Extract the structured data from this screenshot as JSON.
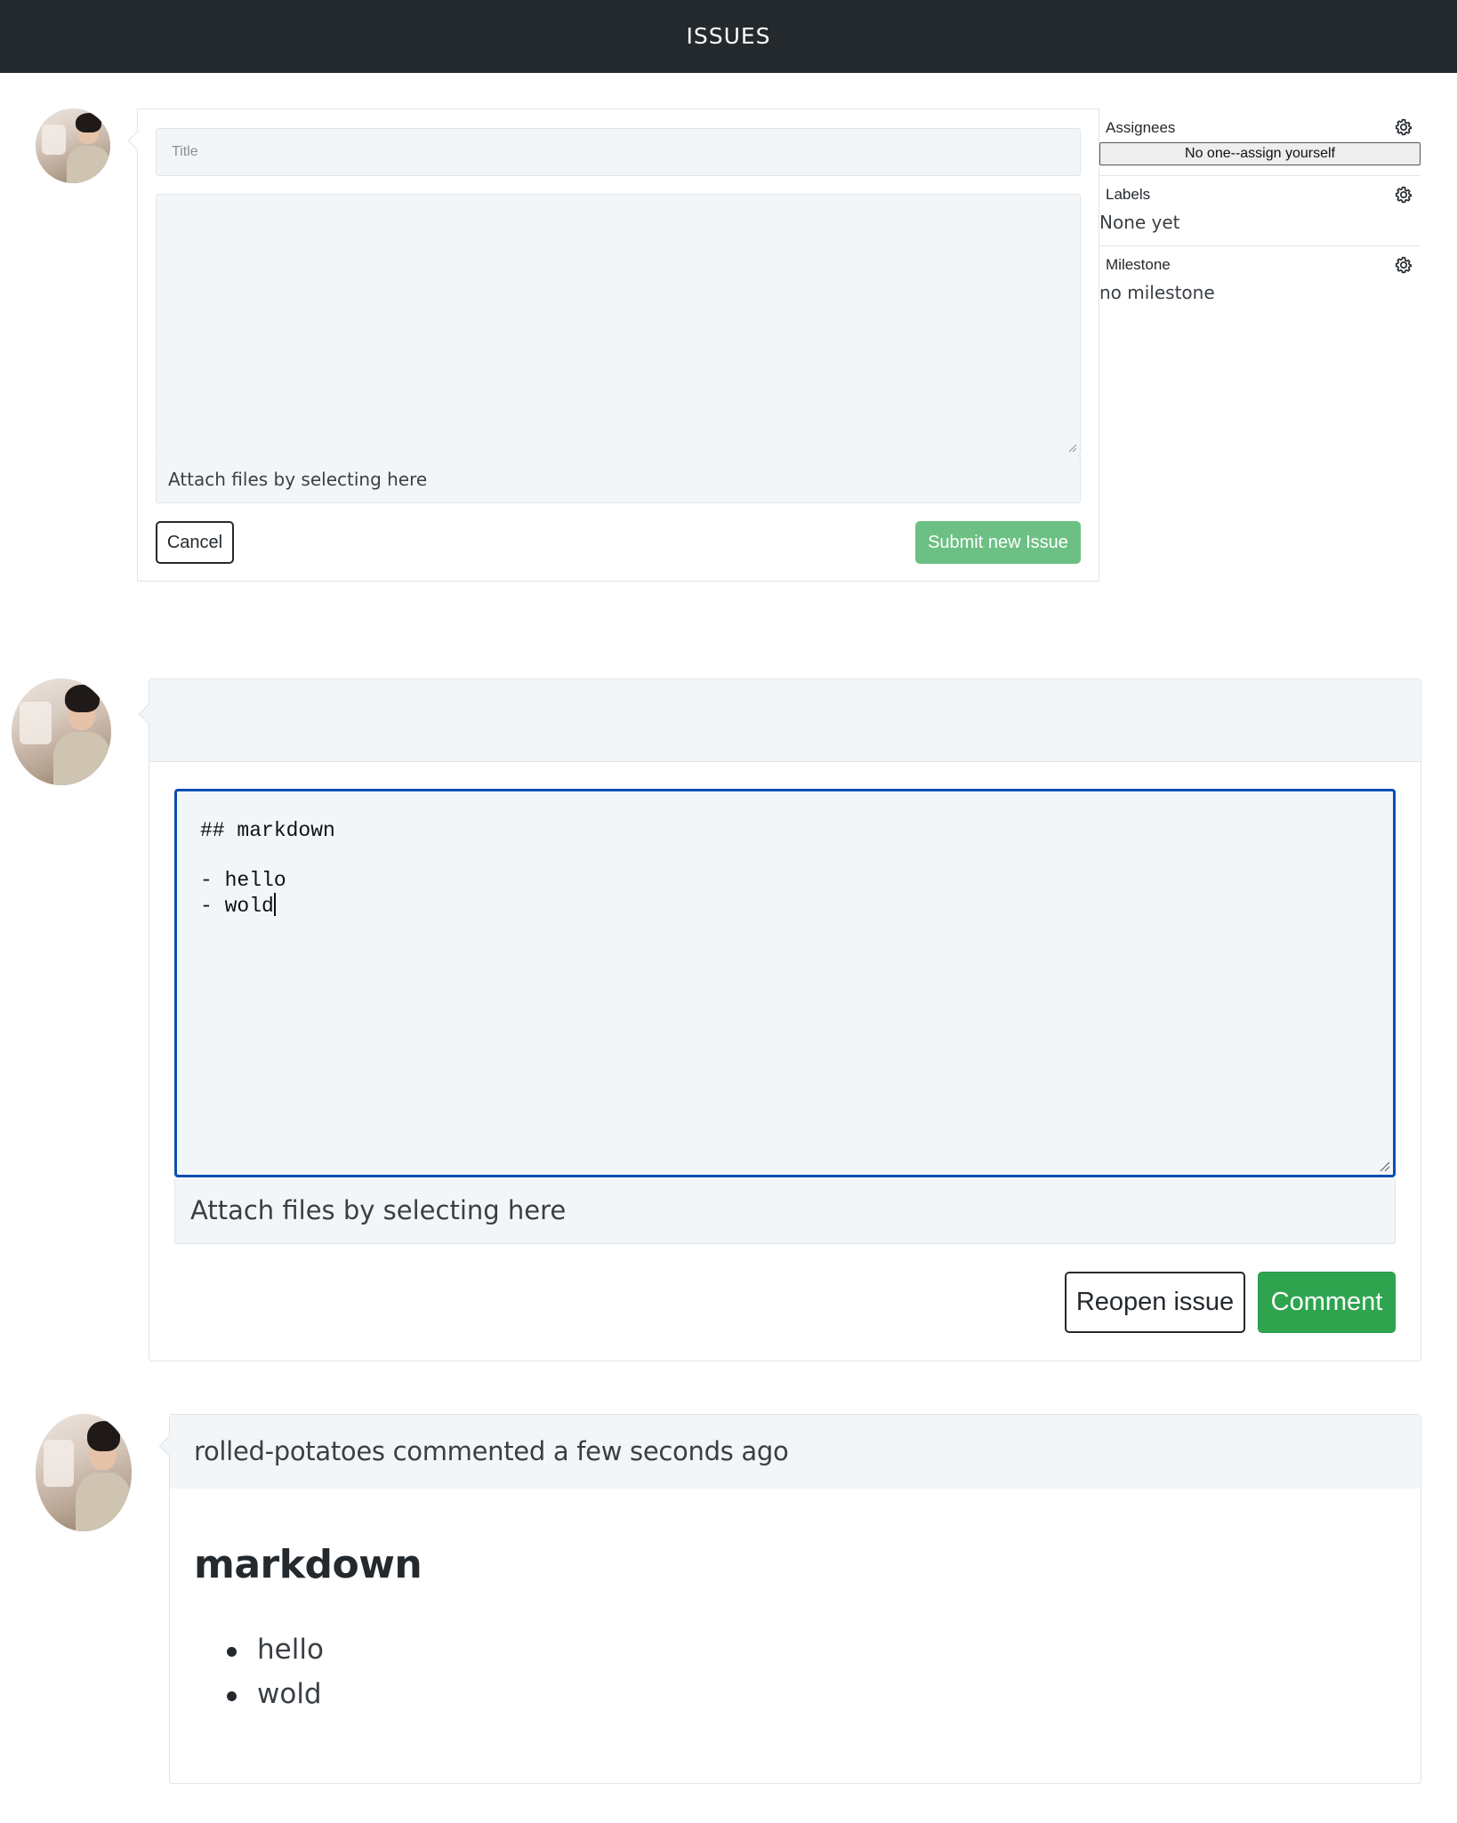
{
  "header": {
    "title": "ISSUES"
  },
  "new_issue": {
    "title_placeholder": "Title",
    "attach_text": "Attach files by selecting here",
    "cancel_label": "Cancel",
    "submit_label": "Submit new Issue"
  },
  "sidebar": {
    "assignees": {
      "heading": "Assignees",
      "button_label": "No one--assign yourself"
    },
    "labels": {
      "heading": "Labels",
      "value": "None yet"
    },
    "milestone": {
      "heading": "Milestone",
      "value": "no milestone"
    }
  },
  "comment_form": {
    "textarea_lines": [
      "## markdown",
      "",
      "- hello",
      "- wold"
    ],
    "attach_text": "Attach files by selecting here",
    "reopen_label": "Reopen issue",
    "comment_label": "Comment"
  },
  "comment": {
    "header": "rolled-potatoes commented a few seconds ago",
    "heading": "markdown",
    "items": [
      "hello",
      "wold"
    ]
  },
  "colors": {
    "topbar": "#24292e",
    "green": "#2ea44f",
    "focus_border": "#0366d6"
  },
  "icons": {
    "settings": "gear-icon",
    "avatar": "user-avatar"
  }
}
